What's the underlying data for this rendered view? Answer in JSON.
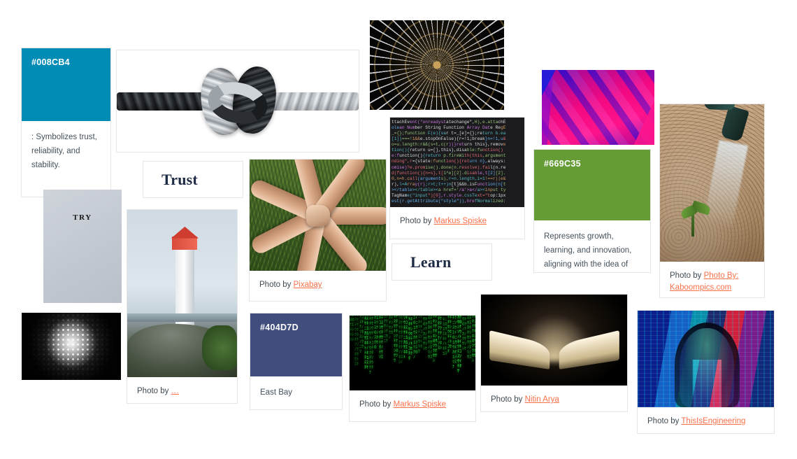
{
  "board": {
    "background": "#ffffff",
    "link_color": "#f9714a",
    "text_color": "#44515c"
  },
  "cards": {
    "swatch_blue": {
      "hex_label": "#008CB4",
      "color": "#008CB4",
      "caption": ": Symbolizes trust, reliability, and stability."
    },
    "swatch_green": {
      "hex_label": "#669C35",
      "color": "#669C35",
      "caption": "Represents growth, learning, and innovation, aligning with the idea of progress."
    },
    "swatch_navy": {
      "hex_label": "#404D7D",
      "color": "#404D7D",
      "caption": "East Bay"
    },
    "word_trust": {
      "word": "Trust"
    },
    "word_learn": {
      "word": "Learn"
    },
    "try_card": {
      "word": "TRY"
    }
  },
  "photos": [
    {
      "id": "rope-knot",
      "alt": "Two ropes tied together in a knot",
      "credit_prefix": "",
      "credit_link": ""
    },
    {
      "id": "dome-tunnel",
      "alt": "Dark radial dome structure with lights",
      "credit_prefix": "",
      "credit_link": ""
    },
    {
      "id": "code-screen",
      "alt": "Dark code editor screenshot with colored syntax",
      "credit_prefix": "Photo by",
      "credit_link": "Markus Spiske"
    },
    {
      "id": "hands-circle",
      "alt": "Hands joined in a circle over grass",
      "credit_prefix": "Photo by",
      "credit_link": "Pixabay"
    },
    {
      "id": "pink-paint",
      "alt": "Abstract pink and blue paint strokes",
      "credit_prefix": "",
      "credit_link": ""
    },
    {
      "id": "watering-sprout",
      "alt": "Watering a small sprout in soil",
      "credit_prefix": "Photo by",
      "credit_link": "Photo By: Kaboompics.com"
    },
    {
      "id": "halftone-dots",
      "alt": "Black and white halftone dot gradient",
      "credit_prefix": "",
      "credit_link": ""
    },
    {
      "id": "lighthouse",
      "alt": "Red and white lighthouse on a rocky cliff",
      "credit_prefix": "Photo by",
      "credit_link": "…"
    },
    {
      "id": "matrix-rain",
      "alt": "Green matrix style falling code on black",
      "credit_prefix": "Photo by",
      "credit_link": "Markus Spiske"
    },
    {
      "id": "open-book",
      "alt": "Glowing open book in the dark",
      "credit_prefix": "Photo by",
      "credit_link": "Nitin Arya"
    },
    {
      "id": "tech-portrait",
      "alt": "Person with projected colorful data light",
      "credit_prefix": "Photo by",
      "credit_link": "ThisIsEngineering"
    }
  ],
  "code_lines": [
    "ttachEvent(\"onreadystatechange\",H),e.attachE",
    "olean Number String Function Array Date RegE",
    "_={};function F(e){var t=_[e]={};return b.ea",
    "[1])===!1&&e.stopOnFalse){r=!1;break}n=!1,u&",
    "o=u.length:r&&(s=t,c(r))}return this},remove",
    "tion(){return u=[],this},disable:function()",
    "e:function(){return p.fireWith(this,argument",
    "nding\",r={state:function(){return n},always:",
    "omise)?e.promise().done(n.resolve).fail(n.re",
    "d(function(){n=s},t[1^e][2].disable,t[2][2].",
    "0,n=h.call(arguments),r=n.length,i=1!==r||e&",
    "r),l=Array(r);r>t;t++)n[t]&&b.isFunction(n[t",
    "></table></table><a href='/a'>a</a><input ty",
    "TagName(\"input\")[0],r.style.cssText=\"top:1px",
    "est(r.getAttribute(\"style\")),hrefNormalized:"
  ]
}
